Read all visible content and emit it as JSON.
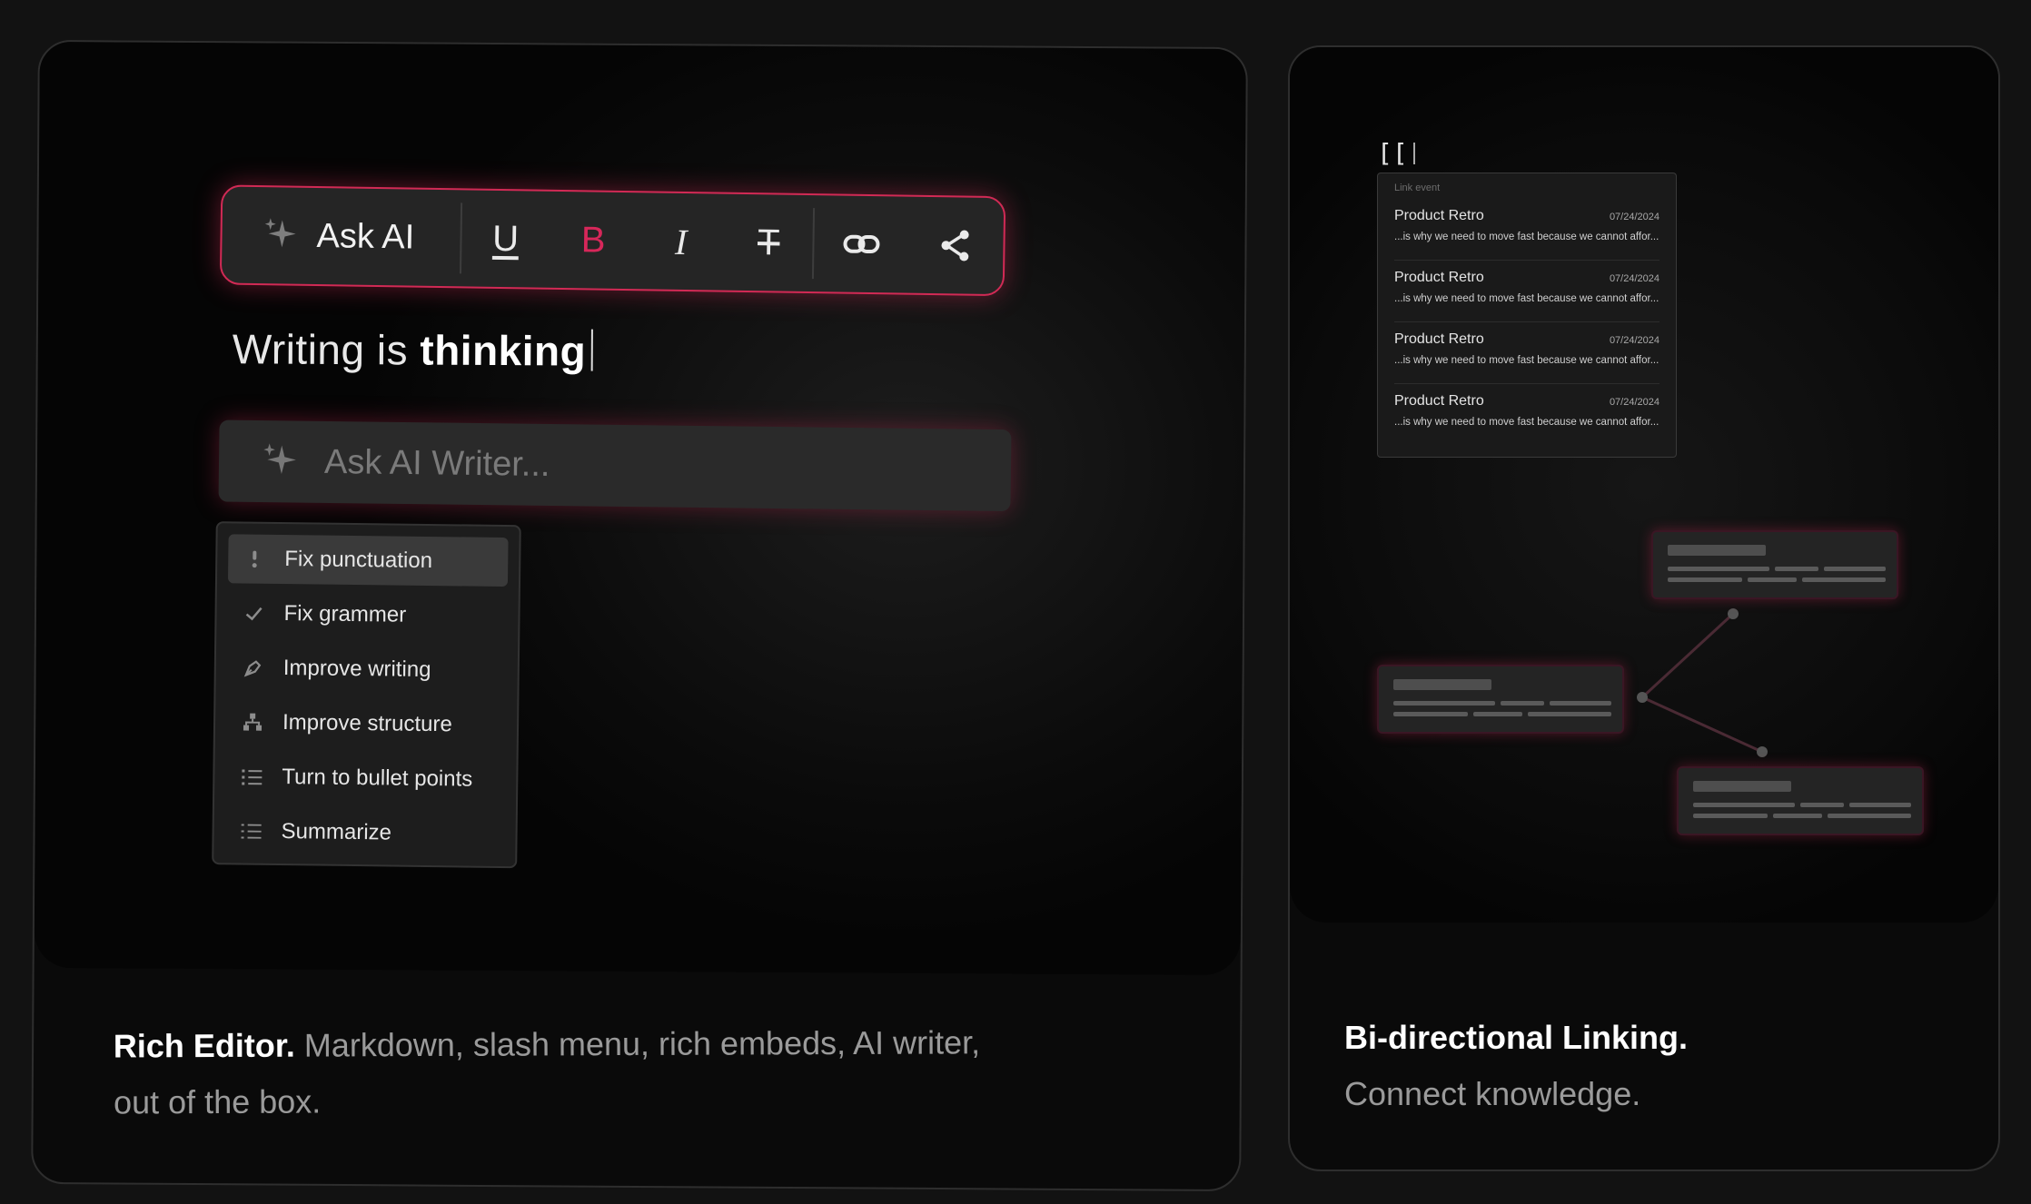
{
  "editor_card": {
    "toolbar": {
      "ask_ai_label": "Ask AI",
      "buttons": [
        {
          "id": "underline",
          "glyph": "U"
        },
        {
          "id": "bold",
          "glyph": "B"
        },
        {
          "id": "italic",
          "glyph": "I"
        },
        {
          "id": "strikethrough",
          "glyph": "T"
        }
      ],
      "accent_color": "#d12a55"
    },
    "writing_text": {
      "normal": "Writing is ",
      "bold": "thinking"
    },
    "ai_input": {
      "placeholder": "Ask AI Writer..."
    },
    "menu": {
      "items": [
        {
          "label": "Fix punctuation",
          "icon": "punctuation-icon",
          "selected": true
        },
        {
          "label": "Fix grammer",
          "icon": "check-icon",
          "selected": false
        },
        {
          "label": "Improve writing",
          "icon": "pen-nib-icon",
          "selected": false
        },
        {
          "label": "Improve structure",
          "icon": "hierarchy-icon",
          "selected": false
        },
        {
          "label": "Turn to bullet points",
          "icon": "bullet-list-icon",
          "selected": false
        },
        {
          "label": "Summarize",
          "icon": "summary-list-icon",
          "selected": false
        }
      ]
    },
    "caption": {
      "strong": "Rich Editor.",
      "text": " Markdown, slash menu, rich embeds, AI writer, out of the box."
    }
  },
  "link_card": {
    "trigger_text": "[[",
    "popup": {
      "header": "Link event",
      "items": [
        {
          "title": "Product Retro",
          "date": "07/24/2024",
          "snippet": "...is why we need to move fast because we cannot affor..."
        },
        {
          "title": "Product Retro",
          "date": "07/24/2024",
          "snippet": "...is why we need to move fast because we cannot affor..."
        },
        {
          "title": "Product Retro",
          "date": "07/24/2024",
          "snippet": "...is why we need to move fast because we cannot affor..."
        },
        {
          "title": "Product Retro",
          "date": "07/24/2024",
          "snippet": "...is why we need to move fast because we cannot affor..."
        }
      ]
    },
    "caption": {
      "strong": "Bi-directional Linking.",
      "text": "Connect knowledge."
    }
  }
}
